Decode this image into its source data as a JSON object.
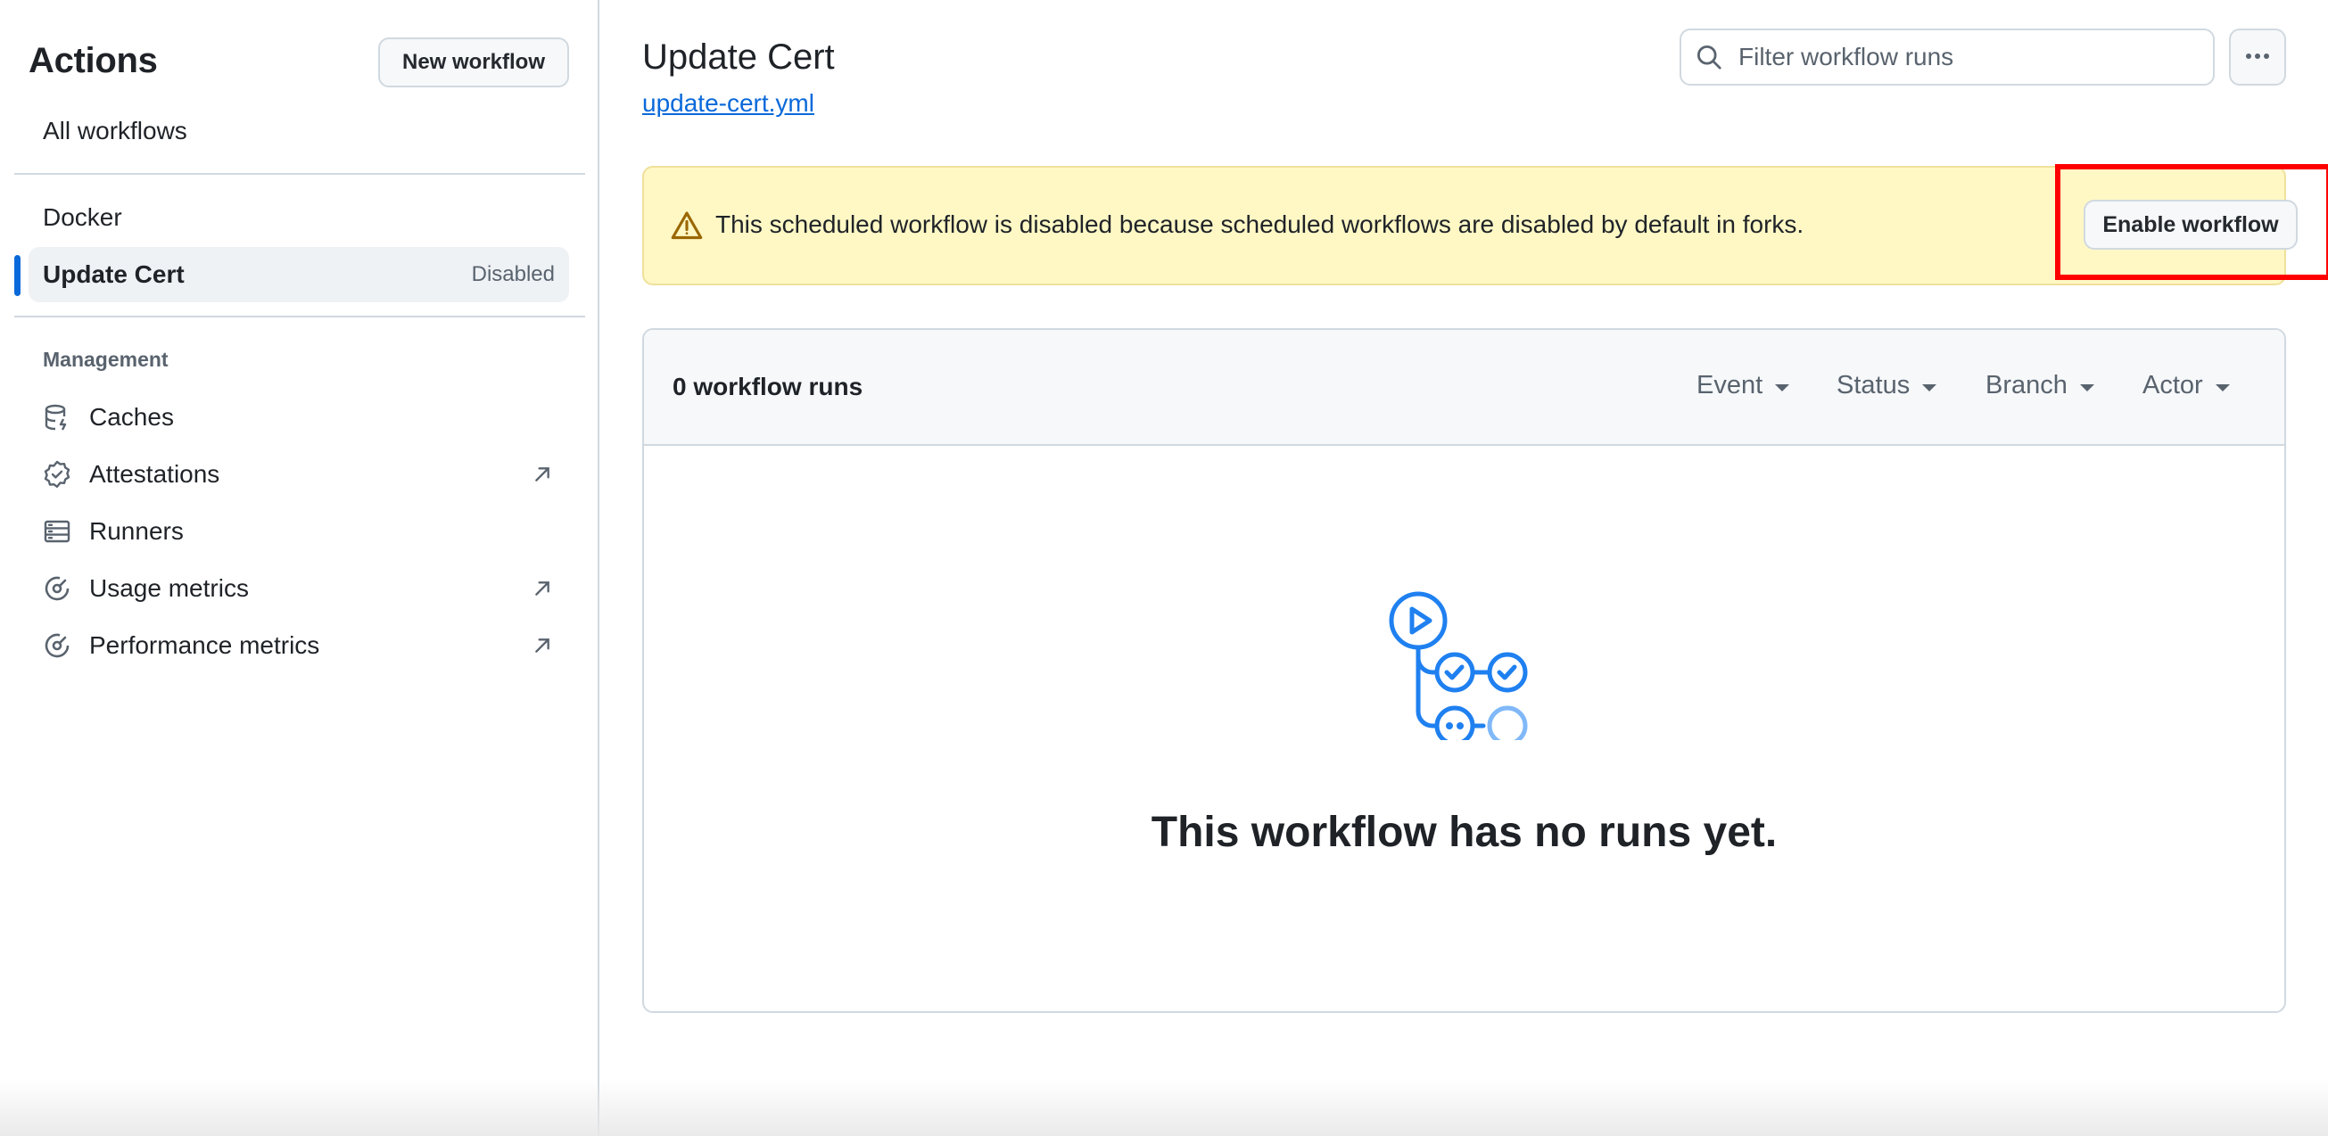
{
  "sidebar": {
    "title": "Actions",
    "new_workflow_label": "New workflow",
    "all_workflows_label": "All workflows",
    "workflows": [
      {
        "label": "Docker",
        "badge": ""
      },
      {
        "label": "Update Cert",
        "badge": "Disabled",
        "active": true
      }
    ],
    "management_heading": "Management",
    "management_items": [
      {
        "label": "Caches",
        "icon": "database-icon",
        "external": false
      },
      {
        "label": "Attestations",
        "icon": "verified-badge-icon",
        "external": true
      },
      {
        "label": "Runners",
        "icon": "server-icon",
        "external": false
      },
      {
        "label": "Usage metrics",
        "icon": "meter-icon",
        "external": true
      },
      {
        "label": "Performance metrics",
        "icon": "meter-icon",
        "external": true
      }
    ]
  },
  "header": {
    "title": "Update Cert",
    "file_link": "update-cert.yml",
    "search_placeholder": "Filter workflow runs",
    "more_options_icon": "kebab-horizontal-icon"
  },
  "flash": {
    "message": "This scheduled workflow is disabled because scheduled workflows are disabled by default in forks.",
    "button_label": "Enable workflow",
    "icon": "alert-icon",
    "highlight_color": "#ff0000"
  },
  "runs": {
    "count_label": "0 workflow runs",
    "filters": [
      "Event",
      "Status",
      "Branch",
      "Actor"
    ],
    "empty_title": "This workflow has no runs yet.",
    "empty_icon": "workflow-icon"
  },
  "colors": {
    "accent": "#0969da",
    "warning_bg": "#fff8c5",
    "icon_blue": "#1f80f0"
  }
}
